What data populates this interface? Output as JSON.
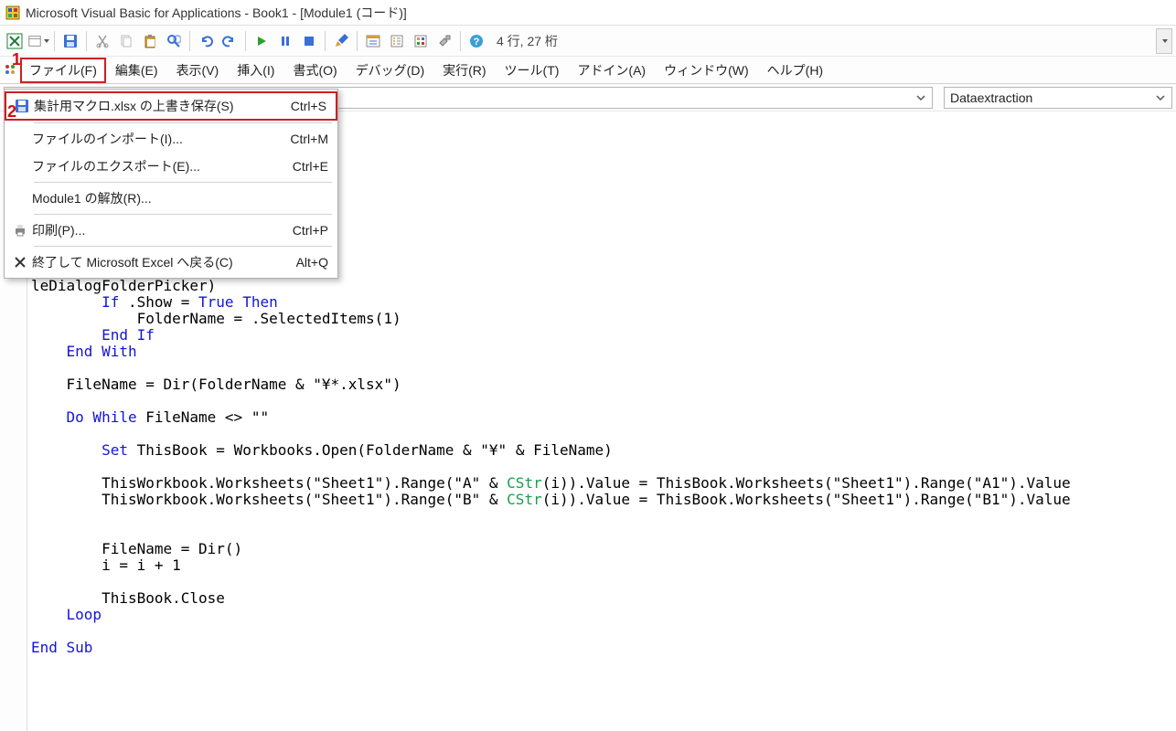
{
  "title": "Microsoft Visual Basic for Applications - Book1 - [Module1 (コード)]",
  "toolbar_status": "4 行, 27 桁",
  "menubar": {
    "file": "ファイル(F)",
    "edit": "編集(E)",
    "view": "表示(V)",
    "insert": "挿入(I)",
    "format": "書式(O)",
    "debug": "デバッグ(D)",
    "run": "実行(R)",
    "tools": "ツール(T)",
    "addins": "アドイン(A)",
    "window": "ウィンドウ(W)",
    "help": "ヘルプ(H)"
  },
  "file_menu": {
    "save": {
      "label": "集計用マクロ.xlsx の上書き保存(S)",
      "shortcut": "Ctrl+S"
    },
    "import": {
      "label": "ファイルのインポート(I)...",
      "shortcut": "Ctrl+M"
    },
    "export": {
      "label": "ファイルのエクスポート(E)...",
      "shortcut": "Ctrl+E"
    },
    "release": {
      "label": "Module1 の解放(R)...",
      "shortcut": ""
    },
    "print": {
      "label": "印刷(P)...",
      "shortcut": "Ctrl+P"
    },
    "close": {
      "label": "終了して Microsoft Excel へ戻る(C)",
      "shortcut": "Alt+Q"
    }
  },
  "proc_combo": "Dataextraction",
  "callouts": {
    "one": "1",
    "two": "2"
  },
  "code": {
    "l1": "leDialogFolderPicker)",
    "l2a": "If",
    "l2b": " .Show = ",
    "l2c": "True Then",
    "l3": "            FolderName = .SelectedItems(1)",
    "l4": "End If",
    "l5": "End With",
    "l6": "    FileName = Dir(FolderName & \"¥*.xlsx\")",
    "l7a": "Do While",
    "l7b": " FileName <> \"\"",
    "l8a": "Set",
    "l8b": " ThisBook = Workbooks.Open(FolderName & \"¥\" & FileName)",
    "l9a": "        ThisWorkbook.Worksheets(\"Sheet1\").Range(\"A\" & ",
    "l9b": "CStr",
    "l9c": "(i)).Value = ThisBook.Worksheets(\"Sheet1\").Range(\"A1\").Value",
    "l10a": "        ThisWorkbook.Worksheets(\"Sheet1\").Range(\"B\" & ",
    "l10b": "CStr",
    "l10c": "(i)).Value = ThisBook.Worksheets(\"Sheet1\").Range(\"B1\").Value",
    "l11": "        FileName = Dir()",
    "l12": "        i = i + 1",
    "l13": "        ThisBook.Close",
    "l14": "Loop",
    "l15": "End Sub"
  }
}
